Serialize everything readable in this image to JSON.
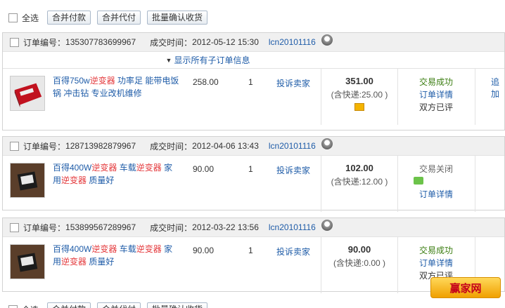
{
  "toolbar": {
    "select_all": "全选",
    "merge_pay": "合并付款",
    "merge_pay_for_other": "合并代付",
    "batch_confirm": "批量确认收货"
  },
  "orders": [
    {
      "order_no_label": "订单编号：",
      "order_no": "135307783699967",
      "time_label": "成交时间：",
      "time": "2012-05-12 15:30",
      "seller": "lcn20101116",
      "expand_text": "显示所有子订单信息",
      "title_parts": [
        "百得750w",
        "逆变器",
        " 功率足 能带电饭锅 冲击钻 专业改机维修"
      ],
      "price": "258.00",
      "qty": "1",
      "complain": "投诉卖家",
      "total": "351.00",
      "shipping": "(含快递:25.00 )",
      "status": "交易成功",
      "detail": "订单详情",
      "review": "双方已评",
      "op": "追加"
    },
    {
      "order_no_label": "订单编号：",
      "order_no": "128713982879967",
      "time_label": "成交时间：",
      "time": "2012-04-06 13:43",
      "seller": "lcn20101116",
      "title_parts": [
        "百得400W",
        "逆变器",
        " 车载",
        "逆变器",
        " 家用",
        "逆变器",
        " 质量好"
      ],
      "price": "90.00",
      "qty": "1",
      "complain": "投诉卖家",
      "total": "102.00",
      "shipping": "(含快递:12.00 )",
      "status": "交易关闭",
      "detail": "订单详情"
    },
    {
      "order_no_label": "订单编号：",
      "order_no": "153899567289967",
      "time_label": "成交时间：",
      "time": "2012-03-22 13:56",
      "seller": "lcn20101116",
      "title_parts": [
        "百得400W",
        "逆变器",
        " 车载",
        "逆变器",
        " 家用",
        "逆变器",
        " 质量好"
      ],
      "price": "90.00",
      "qty": "1",
      "complain": "投诉卖家",
      "total": "90.00",
      "shipping": "(含快递:0.00 )",
      "status": "交易成功",
      "detail": "订单详情",
      "review": "双方已评"
    }
  ],
  "watermark": "赢家网"
}
